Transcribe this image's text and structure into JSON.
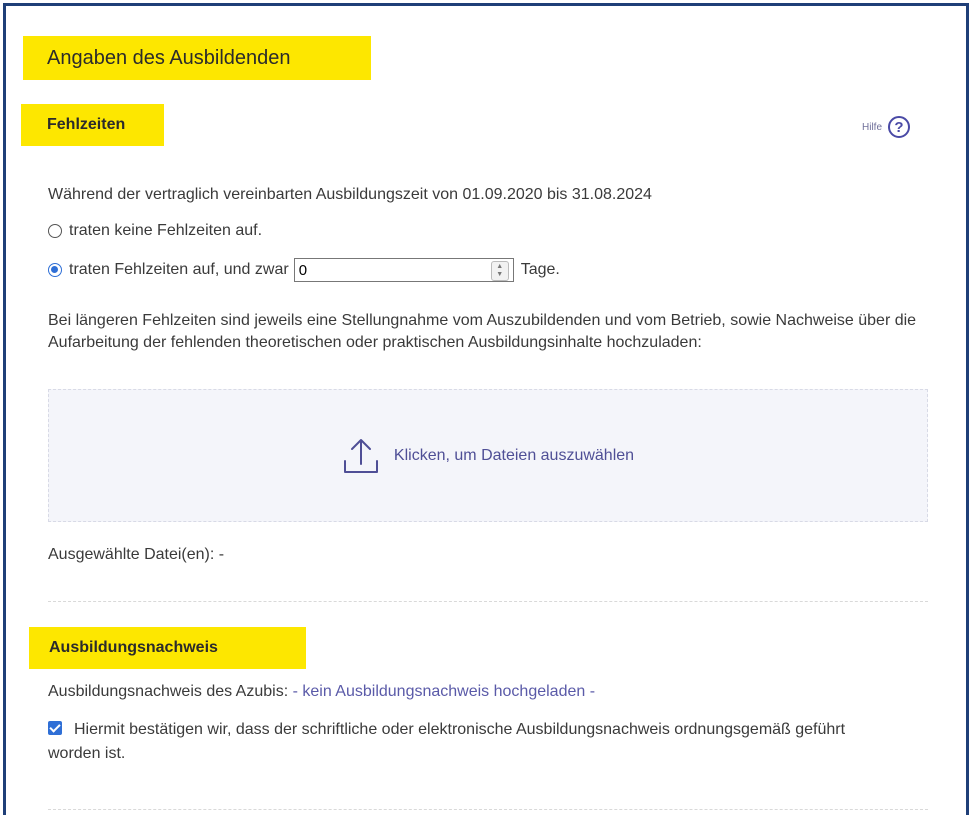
{
  "section": {
    "title": "Angaben des Ausbildenden"
  },
  "fehlzeiten": {
    "title": "Fehlzeiten",
    "help_label": "Hilfe",
    "help_icon": "question-circle-icon",
    "period_text": "Während der vertraglich vereinbarten Ausbildungszeit von 01.09.2020 bis 31.08.2024",
    "option_none": "traten keine Fehlzeiten auf.",
    "option_some": "traten Fehlzeiten auf, und zwar",
    "selected_option": "option_some",
    "days_value": "0",
    "days_unit": "Tage.",
    "info_text": "Bei längeren Fehlzeiten sind jeweils eine Stellungnahme vom Auszubildenden und vom Betrieb, sowie Nachweise über die Aufarbeitung der fehlenden theoretischen oder praktischen Ausbildungsinhalte hochzuladen:",
    "upload_label": "Klicken, um Dateien auszuwählen",
    "upload_icon": "upload-icon",
    "selected_files_label": "Ausgewählte Datei(en): -"
  },
  "ausbildungsnachweis": {
    "title": "Ausbildungsnachweis",
    "label": "Ausbildungsnachweis des Azubis:",
    "status": "- kein Ausbildungsnachweis hochgeladen -",
    "confirm_checked": true,
    "confirm_text": "Hiermit bestätigen wir, dass der schriftliche oder elektronische Ausbildungsnachweis ordnungsgemäß geführt worden ist."
  },
  "colors": {
    "highlight": "#fde700",
    "accent": "#2f6fd6",
    "link": "#4f4f96",
    "frame": "#1f3f78"
  }
}
